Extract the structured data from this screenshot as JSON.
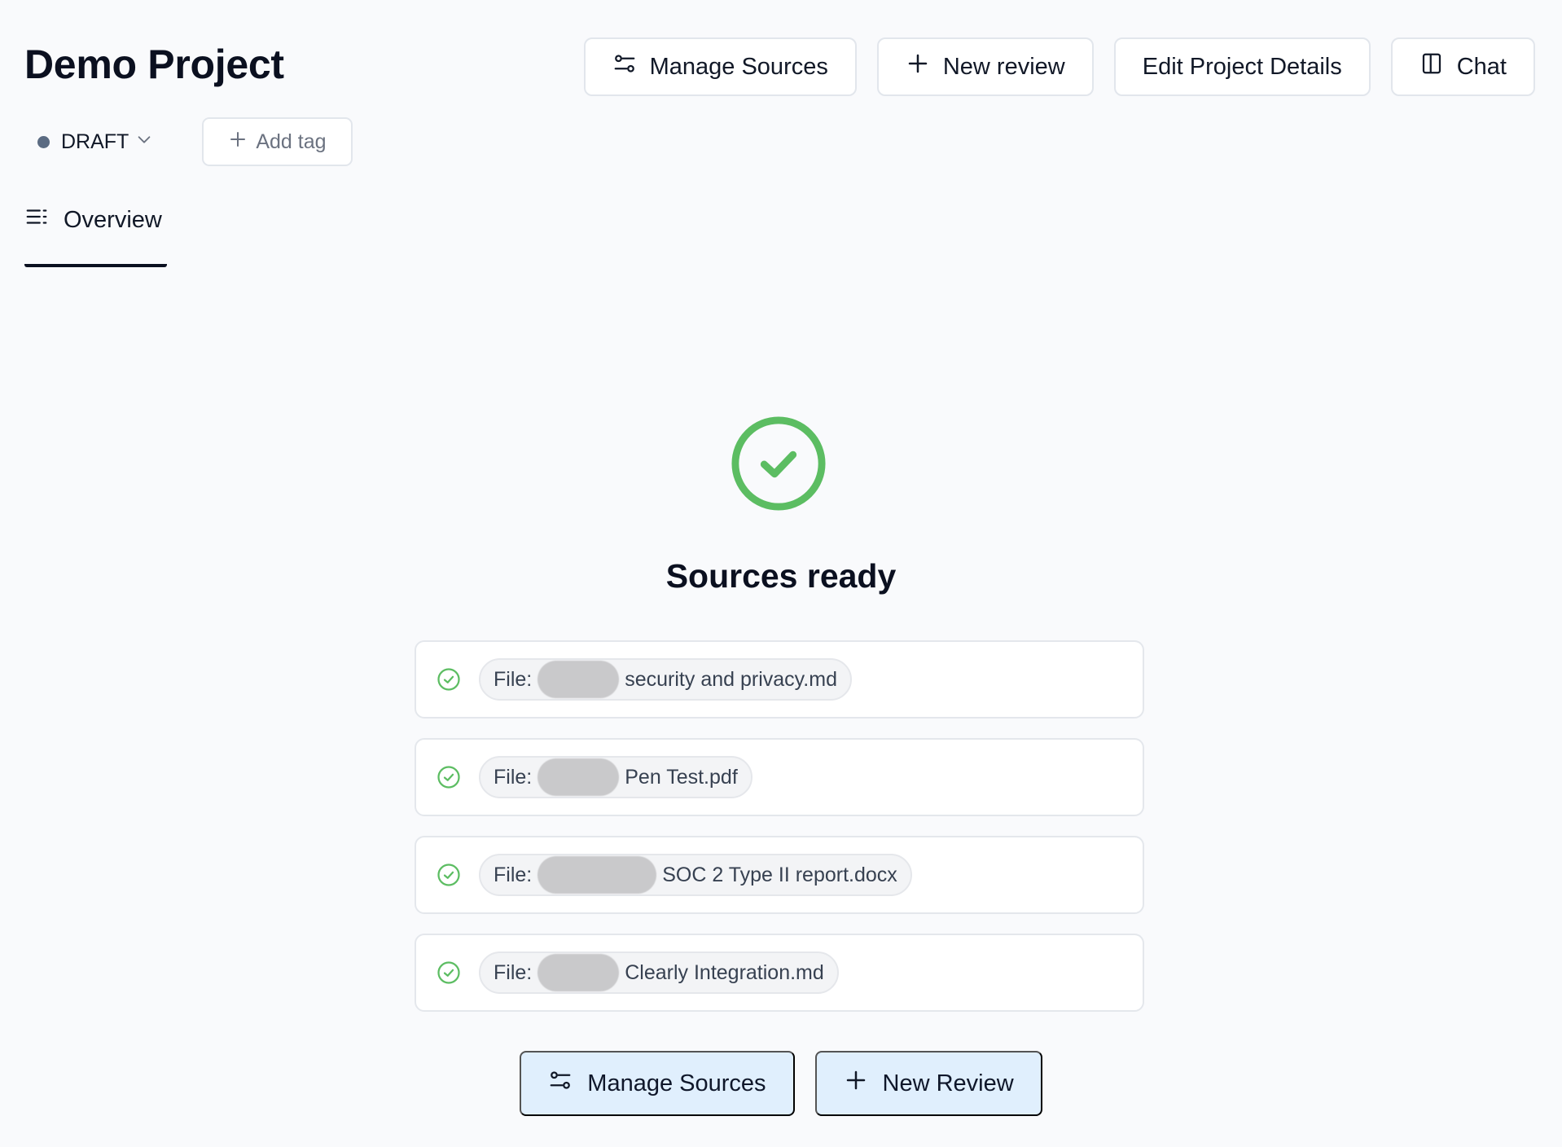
{
  "project": {
    "title": "Demo Project"
  },
  "header_actions": {
    "manage_sources": "Manage Sources",
    "new_review": "New review",
    "edit_details": "Edit Project Details",
    "chat": "Chat"
  },
  "status": {
    "label": "DRAFT",
    "color": "#5b6b82"
  },
  "tags": {
    "add_label": "Add tag"
  },
  "tabs": [
    {
      "label": "Overview",
      "active": true
    }
  ],
  "hero": {
    "title": "Sources ready",
    "icon": "check-circle-icon",
    "color": "#5cbd62"
  },
  "sources": [
    {
      "prefix": "File:",
      "name": "security and privacy.md"
    },
    {
      "prefix": "File:",
      "name": "Pen Test.pdf"
    },
    {
      "prefix": "File:",
      "name": "SOC 2 Type II report.docx"
    },
    {
      "prefix": "File:",
      "name": "Clearly Integration.md"
    }
  ],
  "footer_actions": {
    "manage_sources": "Manage Sources",
    "new_review": "New Review"
  }
}
